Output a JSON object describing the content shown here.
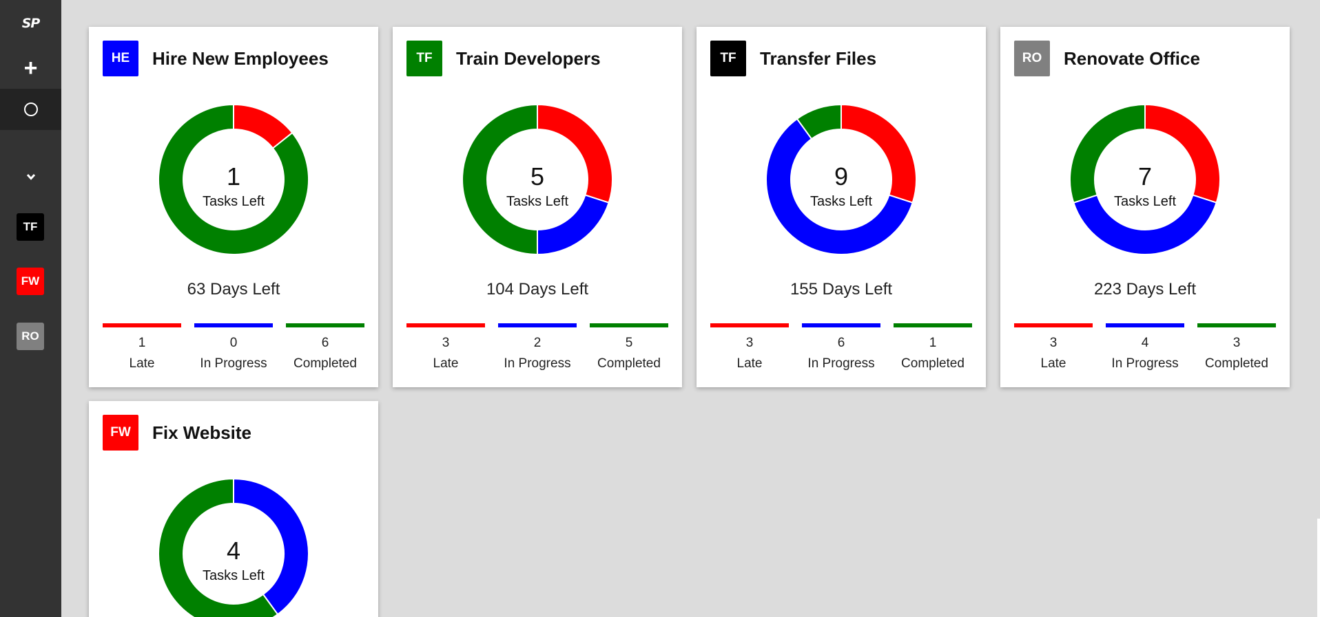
{
  "sidebar": {
    "logo": "SP",
    "add_icon": "+",
    "projects": [
      {
        "initials": "TF",
        "color": "#000000"
      },
      {
        "initials": "FW",
        "color": "#ff0000"
      },
      {
        "initials": "RO",
        "color": "#808080"
      }
    ]
  },
  "colors": {
    "late": "#ff0000",
    "in_progress": "#0000ff",
    "completed": "#008000"
  },
  "cards": [
    {
      "initials": "HE",
      "avatar_color": "#0000ff",
      "title": "Hire New Employees",
      "tasks_left": "1",
      "tasks_label": "Tasks Left",
      "days_left": "63 Days Left",
      "late": "1",
      "in_progress": "0",
      "completed": "6",
      "late_label": "Late",
      "in_progress_label": "In Progress",
      "completed_label": "Completed"
    },
    {
      "initials": "TF",
      "avatar_color": "#008000",
      "title": "Train Developers",
      "tasks_left": "5",
      "tasks_label": "Tasks Left",
      "days_left": "104 Days Left",
      "late": "3",
      "in_progress": "2",
      "completed": "5",
      "late_label": "Late",
      "in_progress_label": "In Progress",
      "completed_label": "Completed"
    },
    {
      "initials": "TF",
      "avatar_color": "#000000",
      "title": "Transfer Files",
      "tasks_left": "9",
      "tasks_label": "Tasks Left",
      "days_left": "155 Days Left",
      "late": "3",
      "in_progress": "6",
      "completed": "1",
      "late_label": "Late",
      "in_progress_label": "In Progress",
      "completed_label": "Completed"
    },
    {
      "initials": "RO",
      "avatar_color": "#808080",
      "title": "Renovate Office",
      "tasks_left": "7",
      "tasks_label": "Tasks Left",
      "days_left": "223 Days Left",
      "late": "3",
      "in_progress": "4",
      "completed": "3",
      "late_label": "Late",
      "in_progress_label": "In Progress",
      "completed_label": "Completed"
    },
    {
      "initials": "FW",
      "avatar_color": "#ff0000",
      "title": "Fix Website",
      "tasks_left": "4",
      "tasks_label": "Tasks Left",
      "late": "0",
      "in_progress": "4",
      "completed": "6"
    }
  ]
}
